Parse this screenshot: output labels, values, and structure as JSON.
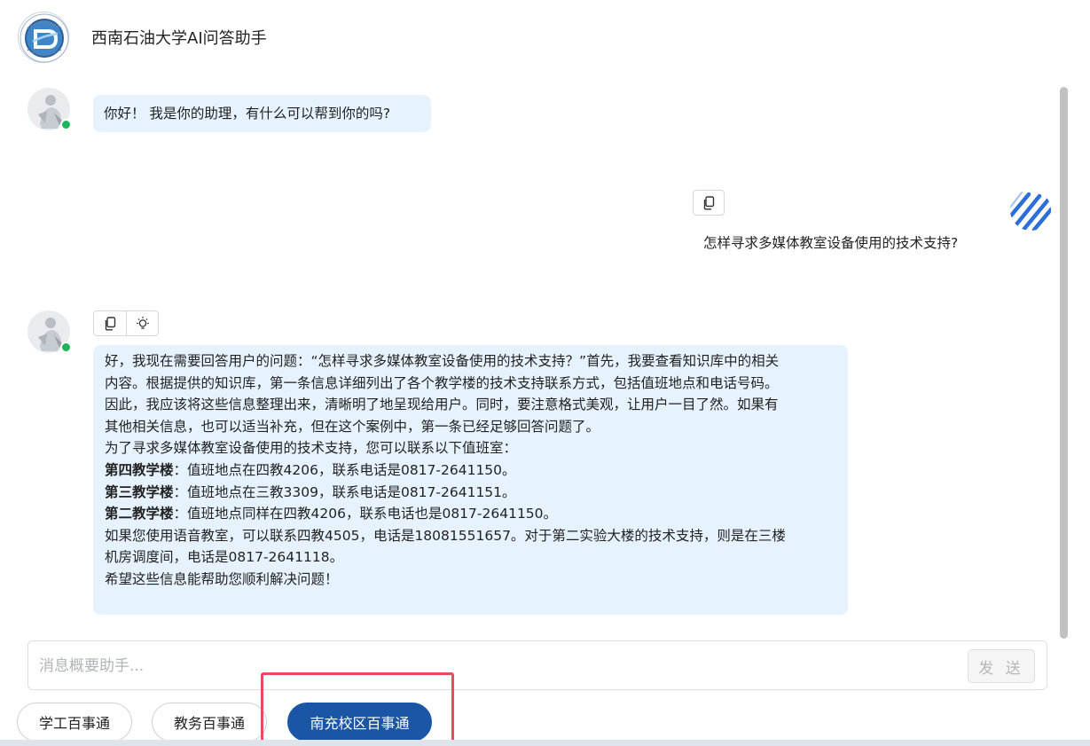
{
  "header": {
    "app_title": "西南石油大学AI问答助手",
    "logo_icon": "university-seal-logo"
  },
  "messages": [
    {
      "role": "assistant",
      "text": "你好！ 我是你的助理，有什么可以帮到你的吗?"
    },
    {
      "role": "user",
      "text": "怎样寻求多媒体教室设备使用的技术支持?"
    },
    {
      "role": "assistant",
      "lines": [
        {
          "text": "好，我现在需要回答用户的问题：“怎样寻求多媒体教室设备使用的技术支持？”首先，我要查看知识库中的相关"
        },
        {
          "text": "内容。根据提供的知识库，第一条信息详细列出了各个教学楼的技术支持联系方式，包括值班地点和电话号码。"
        },
        {
          "text": "因此，我应该将这些信息整理出来，清晰明了地呈现给用户。同时，要注意格式美观，让用户一目了然。如果有"
        },
        {
          "text": "其他相关信息，也可以适当补充，但在这个案例中，第一条已经足够回答问题了。"
        },
        {
          "text": "为了寻求多媒体教室设备使用的技术支持，您可以联系以下值班室："
        },
        {
          "bold": "第四教学楼",
          "text": "：值班地点在四教4206，联系电话是0817-2641150。"
        },
        {
          "bold": "第三教学楼",
          "text": "：值班地点在三教3309，联系电话是0817-2641151。"
        },
        {
          "bold": "第二教学楼",
          "text": "：值班地点同样在四教4206，联系电话也是0817-2641150。"
        },
        {
          "text": "如果您使用语音教室，可以联系四教4505，电话是18081551657。对于第二实验大楼的技术支持，则是在三楼"
        },
        {
          "text": "机房调度间，电话是0817-2641118。"
        },
        {
          "text": "希望这些信息能帮助您顺利解决问题！"
        }
      ]
    }
  ],
  "input": {
    "placeholder": "消息概要助手...",
    "value": "",
    "send_label": "发 送"
  },
  "quick_tabs": [
    {
      "label": "学工百事通",
      "active": false
    },
    {
      "label": "教务百事通",
      "active": false
    },
    {
      "label": "南充校区百事通",
      "active": true
    }
  ],
  "colors": {
    "accent": "#1b56a6",
    "bubble_bg": "#e6f2fd",
    "online_dot": "#1fb35b",
    "highlight_box": "#e64d5c"
  }
}
